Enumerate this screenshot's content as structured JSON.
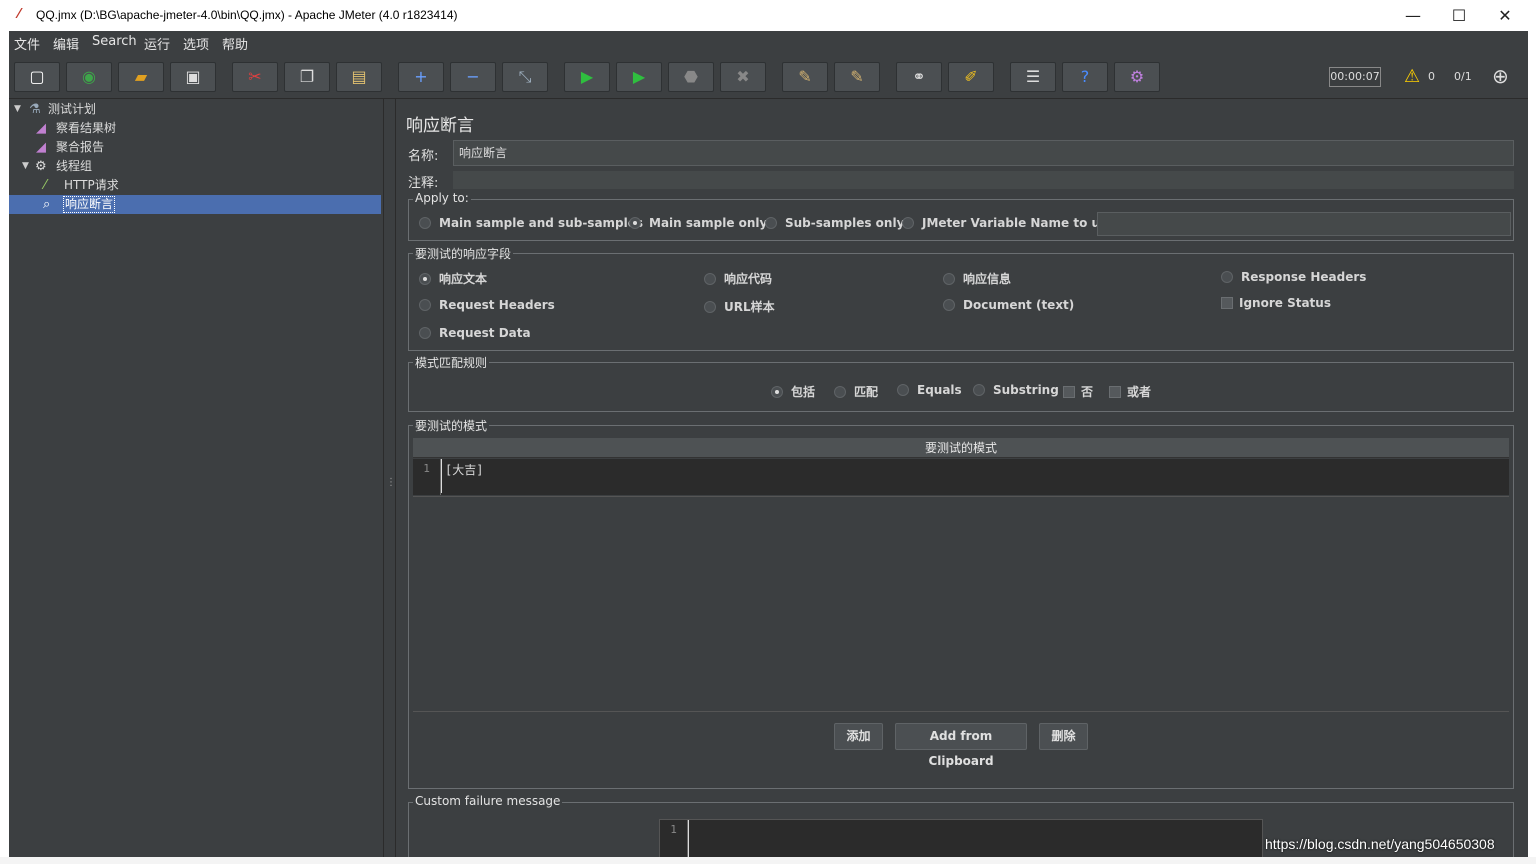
{
  "window": {
    "title": "QQ.jmx (D:\\BG\\apache-jmeter-4.0\\bin\\QQ.jmx) - Apache JMeter (4.0 r1823414)",
    "minimize": "—",
    "maximize": "☐",
    "close": "✕"
  },
  "menu": [
    "文件",
    "编辑",
    "Search",
    "运行",
    "选项",
    "帮助"
  ],
  "toolbar": {
    "icons": [
      "new-icon",
      "templates-icon",
      "open-icon",
      "save-icon",
      "cut-icon",
      "copy-icon",
      "paste-icon",
      "expand-icon",
      "collapse-icon",
      "toggle-icon",
      "start-icon",
      "start-no-pause-icon",
      "stop-icon",
      "shutdown-icon",
      "clear-icon",
      "clear-all-icon",
      "search-icon",
      "reset-search-icon",
      "function-helper-icon",
      "help-icon",
      "remote-icon"
    ],
    "timer": "00:00:07",
    "warnings": "0",
    "threads": "0/1"
  },
  "tree": {
    "items": [
      {
        "label": "测试计划"
      },
      {
        "label": "察看结果树"
      },
      {
        "label": "聚合报告"
      },
      {
        "label": "线程组"
      },
      {
        "label": "HTTP请求"
      },
      {
        "label": "响应断言"
      }
    ]
  },
  "panel": {
    "title": "响应断言",
    "name_label": "名称:",
    "name_value": "响应断言",
    "comment_label": "注释:",
    "apply_to": {
      "legend": "Apply to:",
      "options": [
        "Main sample and sub-samples",
        "Main sample only",
        "Sub-samples only",
        "JMeter Variable Name to use"
      ],
      "selected": "Main sample only"
    },
    "field": {
      "legend": "要测试的响应字段",
      "options": [
        "响应文本",
        "响应代码",
        "响应信息",
        "Response Headers",
        "Request Headers",
        "URL样本",
        "Document (text)",
        "Ignore Status",
        "Request Data"
      ],
      "selected": "响应文本"
    },
    "rules": {
      "legend": "模式匹配规则",
      "options": [
        "包括",
        "匹配",
        "Equals",
        "Substring",
        "否",
        "或者"
      ],
      "selected": "包括"
    },
    "patterns": {
      "legend": "要测试的模式",
      "column": "要测试的模式",
      "line_no": "1",
      "value": "[大吉]"
    },
    "buttons": {
      "add": "添加",
      "add_clipboard": "Add from Clipboard",
      "delete": "删除"
    },
    "failure": {
      "legend": "Custom failure message",
      "line_no": "1"
    }
  },
  "watermark": "https://blog.csdn.net/yang504650308"
}
